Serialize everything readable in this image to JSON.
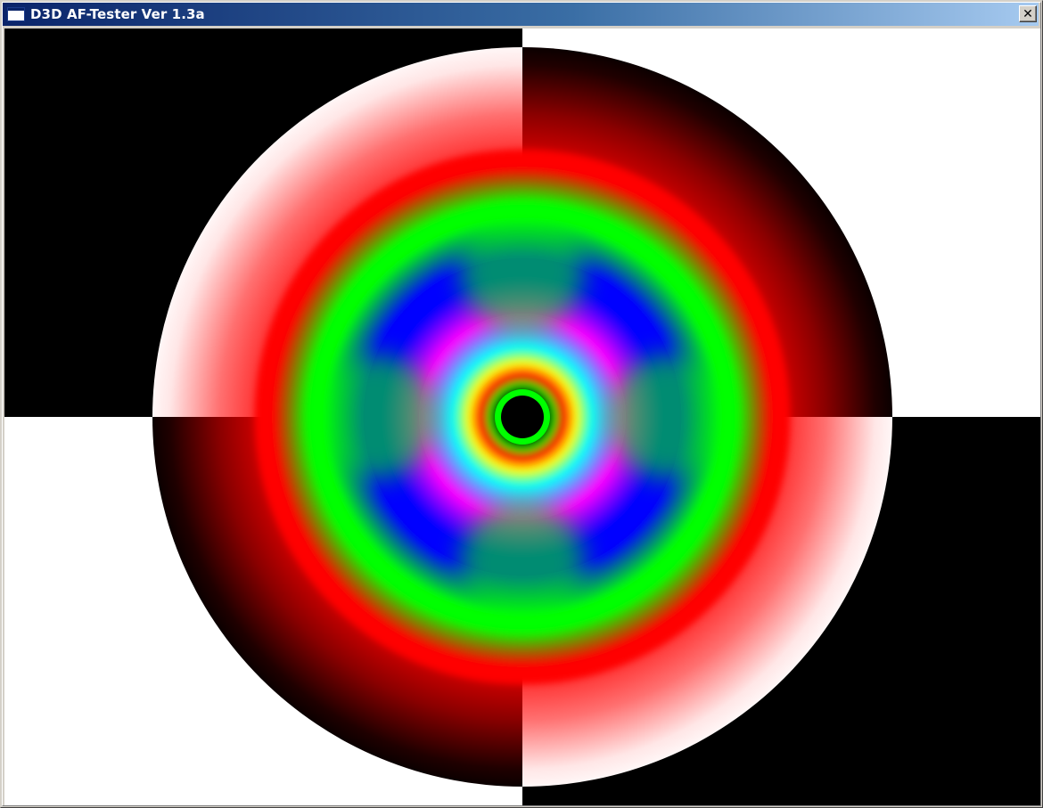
{
  "window": {
    "title": "D3D AF-Tester Ver 1.3a",
    "close_glyph": "✕"
  },
  "icons": {
    "app": "app-window-icon",
    "close": "close-icon"
  },
  "colors": {
    "titlebar_start": "#0a246a",
    "titlebar_end": "#a6caf0",
    "checker_dark": "#000000",
    "checker_light": "#ffffff",
    "ring_red": "#ff0000",
    "ring_green": "#00ff00",
    "ring_blue": "#0000ff",
    "ring_magenta": "#ff00ff",
    "ring_cyan": "#00ffff",
    "ring_yellow": "#ffff00"
  }
}
